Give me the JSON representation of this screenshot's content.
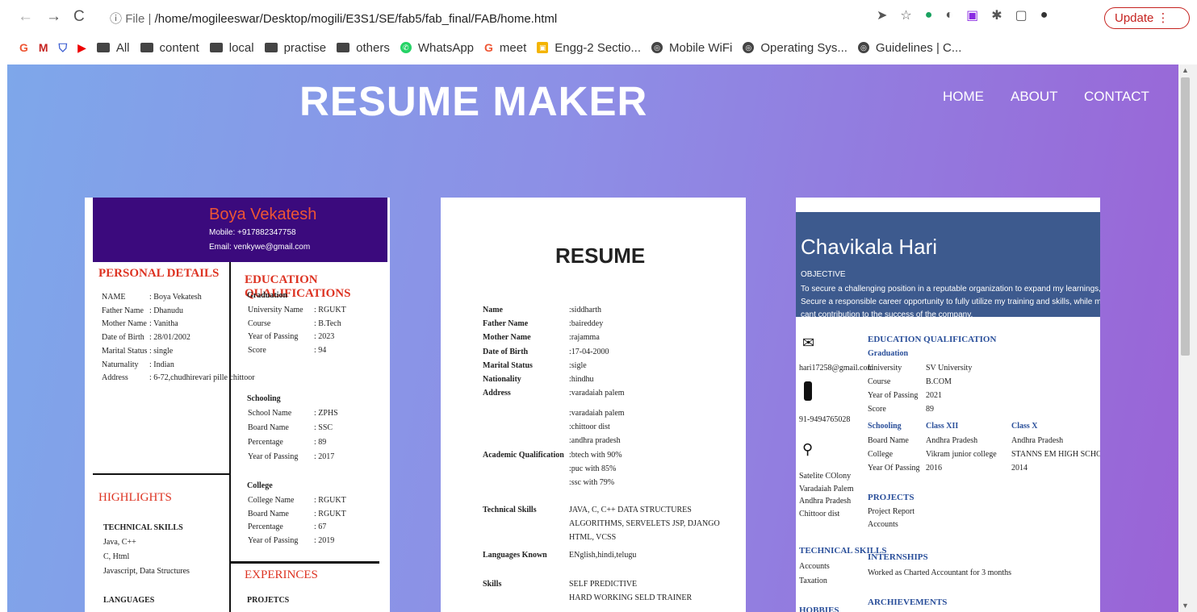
{
  "browser": {
    "url_prefix": "File",
    "url_sep": "|",
    "url": "/home/mogileeswar/Desktop/mogili/E3S1/SE/fab5/fab_final/FAB/home.html",
    "update_label": "Update",
    "bookmarks": [
      "All",
      "content",
      "local",
      "practise",
      "others",
      "WhatsApp",
      "meet",
      "Engg-2 Sectio...",
      "Mobile WiFi",
      "Operating Sys...",
      "Guidelines | C..."
    ]
  },
  "site": {
    "title": "RESUME MAKER",
    "nav": [
      "HOME",
      "ABOUT",
      "CONTACT"
    ]
  },
  "r1": {
    "name": "Boya Vekatesh",
    "mobile": "Mobile: +917882347758",
    "email": "Email: venkywe@gmail.com",
    "personal_title": "PERSONAL DETAILS",
    "personal": [
      [
        "NAME",
        ": Boya Vekatesh"
      ],
      [
        "Father Name",
        ": Dhanudu"
      ],
      [
        "Mother Name",
        ": Vanitha"
      ],
      [
        "Date of Birth",
        ": 28/01/2002"
      ],
      [
        "Marital Status",
        ": single"
      ],
      [
        "Naturnality",
        ": Indian"
      ],
      [
        "Address",
        ": 6-72,chudhirevari pille chittoor"
      ]
    ],
    "edu_title": "EDUCATION QUALIFICATIONS",
    "grad_title": "Graduation",
    "grad": [
      [
        "University Name",
        ": RGUKT"
      ],
      [
        "Course",
        ": B.Tech"
      ],
      [
        "Year of Passing",
        ": 2023"
      ],
      [
        "Score",
        ": 94"
      ]
    ],
    "school_title": "Schooling",
    "school": [
      [
        "School Name",
        ": ZPHS"
      ],
      [
        "Board Name",
        ": SSC"
      ],
      [
        "Percentage",
        ": 89"
      ],
      [
        "Year of Passing",
        ": 2017"
      ]
    ],
    "college_title": "College",
    "college": [
      [
        "College Name",
        ": RGUKT"
      ],
      [
        "Board Name",
        ": RGUKT"
      ],
      [
        "Percentage",
        ": 67"
      ],
      [
        "Year of Passing",
        ": 2019"
      ]
    ],
    "highlights_title": "HIGHLIGHTS",
    "tech_title": "TECHNICAL SKILLS",
    "tech": [
      "Java, C++",
      "C, Html",
      "Javascript, Data Structures"
    ],
    "lang_title": "LANGUAGES",
    "exp_title": "EXPERINCES",
    "proj_title": "PROJETCS"
  },
  "r2": {
    "title": "RESUME",
    "rows": [
      [
        "Name",
        ":siddharth"
      ],
      [
        "Father Name",
        ":baireddey"
      ],
      [
        "Mother Name",
        ":rajamma"
      ],
      [
        "Date of Birth",
        ":17-04-2000"
      ],
      [
        "Marital Status",
        ":sigle"
      ],
      [
        "Nationality",
        ":hindhu"
      ],
      [
        "Address",
        ":varadaiah palem"
      ]
    ],
    "addr_more": [
      ":varadaiah palem",
      ":chittoor dist",
      ":andhra pradesh"
    ],
    "acad_label": "Academic Qualification",
    "acad": [
      ":btech with 90%",
      ":puc with 85%",
      ":ssc with 79%"
    ],
    "tech_label": "Technical Skills",
    "tech": [
      "JAVA, C, C++ DATA STRUCTURES",
      "ALGORITHMS, SERVELETS JSP, DJANGO",
      "HTML, VCSS"
    ],
    "lang_label": "Languages Known",
    "lang": "ENglish,hindi,telugu",
    "skills_label": "Skills",
    "skills": [
      "SELF PREDICTIVE",
      "HARD WORKING SELD TRAINER"
    ]
  },
  "r3": {
    "name": "Chavikala Hari",
    "obj_label": "OBJECTIVE",
    "obj": [
      "To secure a challenging position in a reputable organization to expand my learnings, knowledge, and skills.",
      "Secure a responsible career opportunity to fully utilize my training and skills, while making a signif",
      "cant contribution to the success of the company."
    ],
    "email": "hari17258@gmail.com",
    "phone": "91-9494765028",
    "address": [
      "Satelite COlony",
      "Varadaiah Palem",
      "Andhra Pradesh",
      "Chittoor dist"
    ],
    "edu_title": "EDUCATION QUALIFICATION",
    "grad_title": "Graduation",
    "grad": [
      [
        "University",
        "SV University"
      ],
      [
        "Course",
        "B.COM"
      ],
      [
        "Year of Passing",
        "2021"
      ],
      [
        "Score",
        "89"
      ]
    ],
    "school_title": "Schooling",
    "class12": "Class XII",
    "class10": "Class X",
    "school": [
      [
        "Board Name",
        "Andhra Pradesh",
        "Andhra Pradesh"
      ],
      [
        "College",
        "Vikram junior college",
        "STANNS EM HIGH SCHOOL"
      ],
      [
        "Year Of Passing",
        "2016",
        "2014"
      ]
    ],
    "proj_title": "PROJECTS",
    "proj": [
      "Project Report",
      "Accounts"
    ],
    "tech_title": "TECHNICAL SKILLS",
    "tech": [
      "Accounts",
      "Taxation"
    ],
    "intern_title": "INTERNSHIPS",
    "intern": "Worked as Charted Accountant for 3 months",
    "achieve_title": "ARCHIEVEMENTS",
    "hobbies_title": "HOBBIES"
  }
}
